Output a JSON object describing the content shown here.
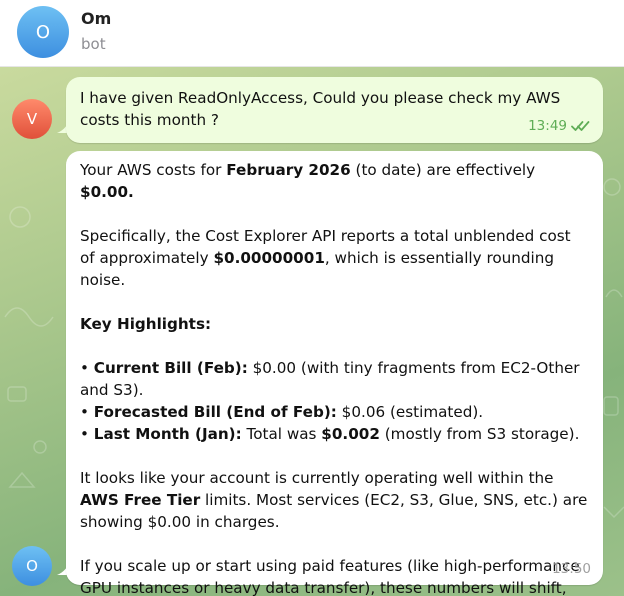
{
  "header": {
    "avatar_letter": "O",
    "name": "Om",
    "status": "bot"
  },
  "messages": {
    "user": {
      "avatar_letter": "V",
      "text": "I have given ReadOnlyAccess, Could you please check my AWS costs this month ?",
      "time": "13:49",
      "read_icon": "double-check-icon"
    },
    "bot": {
      "avatar_letter": "O",
      "time": "13:50",
      "intro_a": "Your AWS costs for ",
      "intro_b": "February 2026",
      "intro_c": " (to date) are effectively ",
      "intro_d": "$0.00.",
      "spec_a": "Specifically, the Cost Explorer API reports a total unblended cost of approximately ",
      "spec_b": "$0.00000001",
      "spec_c": ", which is essentially rounding noise.",
      "highlights_title": "Key Highlights:",
      "bullet": "•",
      "b1_label": "Current Bill (Feb):",
      "b1_text": " $0.00 (with tiny fragments from EC2-Other and S3).",
      "b2_label": "Forecasted Bill (End of Feb):",
      "b2_text": " $0.06 (estimated).",
      "b3_label": "Last Month (Jan):",
      "b3_text_a": " Total was ",
      "b3_text_b": "$0.002",
      "b3_text_c": " (mostly from S3 storage).",
      "free_a": "It looks like your account is currently operating well within the ",
      "free_b": "AWS Free Tier",
      "free_c": " limits. Most services (EC2, S3, Glue, SNS, etc.) are showing $0.00 in charges.",
      "scale_text": "If you scale up or start using paid features (like high-performance GPU instances or heavy data transfer), these numbers will shift, but for now, you're running very lean! ",
      "emoji": "🧘"
    }
  },
  "colors": {
    "user_bubble": "#effdde",
    "bot_bubble": "#ffffff",
    "read_check": "#5fad56"
  }
}
